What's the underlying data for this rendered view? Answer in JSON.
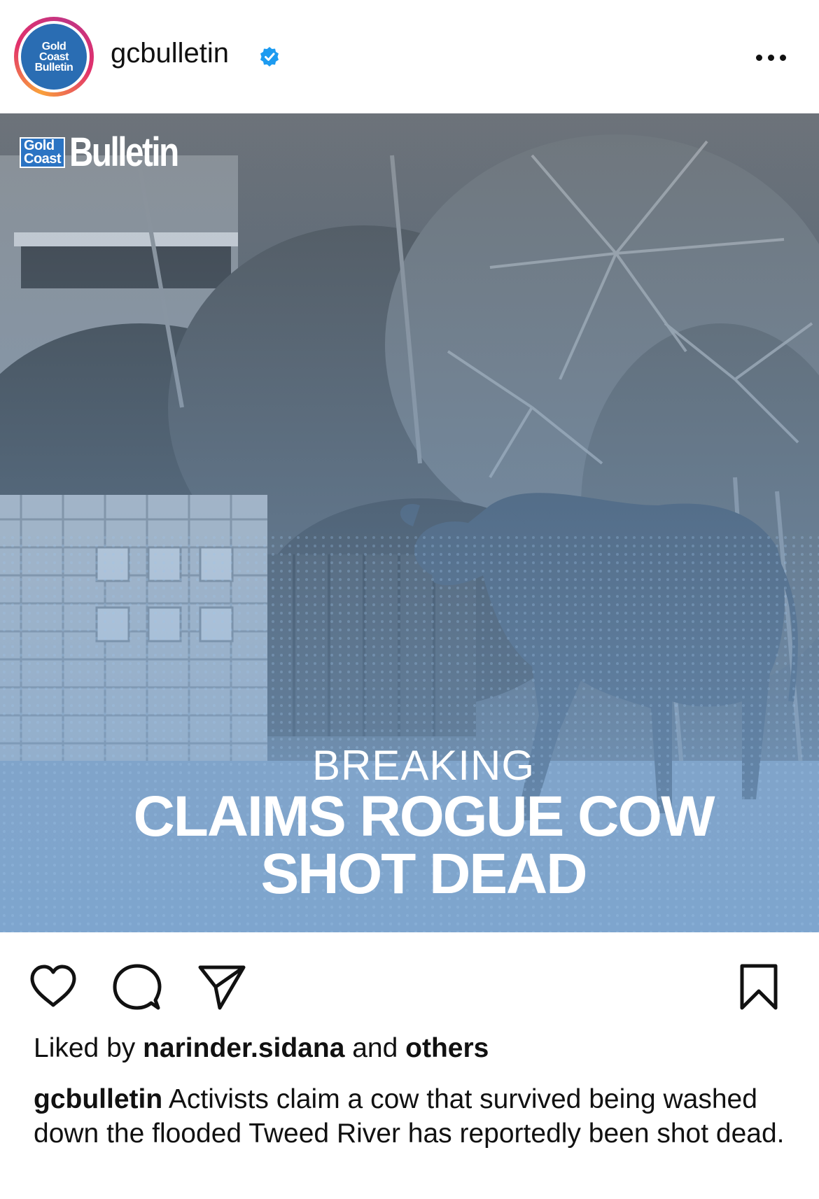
{
  "post": {
    "username": "gcbulletin",
    "avatar_lines": [
      "Gold",
      "Coast",
      "Bulletin"
    ],
    "verified": true,
    "image": {
      "brand_box_lines": [
        "Gold",
        "Coast"
      ],
      "brand_name": "Bulletin",
      "kicker": "BREAKING",
      "headline_line1": "CLAIMS ROGUE COW",
      "headline_line2": "SHOT DEAD"
    },
    "likes": {
      "prefix": "Liked by",
      "user": "narinder.sidana",
      "middle": "and",
      "others": "others"
    },
    "caption": {
      "username": "gcbulletin",
      "text": "Activists claim a cow that survived being washed down the flooded Tweed River has reportedly been shot dead."
    }
  },
  "icons": {
    "like": "heart-icon",
    "comment": "comment-icon",
    "share": "send-icon",
    "save": "bookmark-icon",
    "more": "more-options-icon",
    "verified": "verified-badge-icon"
  },
  "colors": {
    "verified_blue": "#1d9bf0",
    "brand_blue": "#2b74c3"
  }
}
